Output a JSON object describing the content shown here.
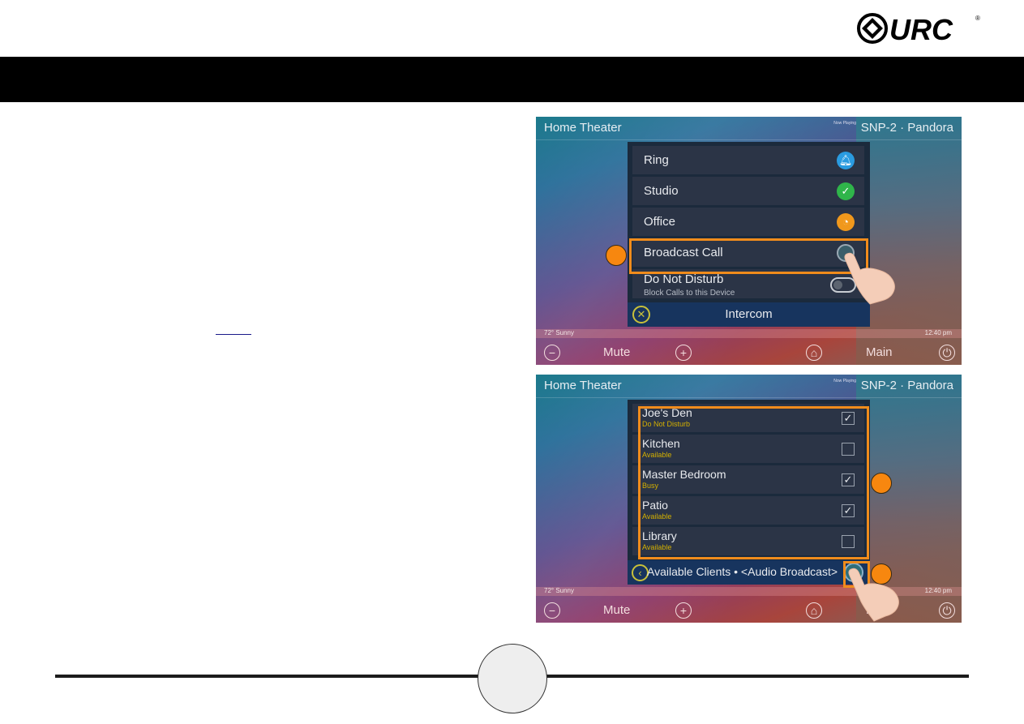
{
  "brand": {
    "logo_text": "URC",
    "registered": "®"
  },
  "screen1": {
    "room_title": "Home Theater",
    "now_playing_label": "Now Playing",
    "source": "SNP-2 · Pandora",
    "menu_items": [
      {
        "label": "Ring",
        "icon": "bell-icon",
        "icon_color": "#2a9be0"
      },
      {
        "label": "Studio",
        "icon": "checkmark-icon",
        "icon_color": "#2fb54a"
      },
      {
        "label": "Office",
        "icon": "clock-icon",
        "icon_color": "#f0981c"
      },
      {
        "label": "Broadcast Call",
        "icon": "broadcast-icon",
        "highlighted": true
      }
    ],
    "dnd": {
      "label": "Do Not Disturb",
      "sublabel": "Block Calls to this Device",
      "enabled": false
    },
    "footer_title": "Intercom",
    "status_left": "72°  Sunny",
    "status_right": "12:40 pm",
    "bottom_bar": {
      "minus": "−",
      "mute": "Mute",
      "plus": "+",
      "main": "Main"
    }
  },
  "screen2": {
    "room_title": "Home Theater",
    "now_playing_label": "Now Playing",
    "source": "SNP-2 · Pandora",
    "clients": [
      {
        "name": "Joe's Den",
        "status": "Do Not Disturb",
        "checked": true
      },
      {
        "name": "Kitchen",
        "status": "Available",
        "checked": false
      },
      {
        "name": "Master Bedroom",
        "status": "Busy",
        "checked": true
      },
      {
        "name": "Patio",
        "status": "Available",
        "checked": true
      },
      {
        "name": "Library",
        "status": "Available",
        "checked": false
      }
    ],
    "footer_title": "Available Clients • <Audio Broadcast>",
    "status_left": "72°  Sunny",
    "status_right": "12:40 pm",
    "bottom_bar": {
      "minus": "−",
      "mute": "Mute",
      "plus": "+",
      "main": "M"
    }
  },
  "glyphs": {
    "check": "✓",
    "close": "✕",
    "back": "‹",
    "power": "⏻"
  },
  "colors": {
    "accent_orange": "#f08c1c",
    "status_yellow": "#d4b000"
  }
}
